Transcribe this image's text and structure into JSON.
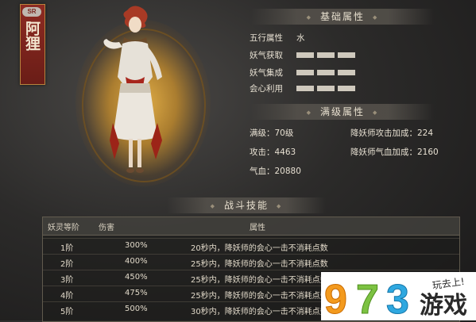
{
  "card": {
    "rarity": "SR",
    "name": "阿狸"
  },
  "sections": {
    "base": "基础属性",
    "max": "满级属性",
    "skills": "战斗技能"
  },
  "base_stats": [
    {
      "label": "五行属性",
      "value": "水"
    },
    {
      "label": "妖气获取",
      "value": ""
    },
    {
      "label": "妖气集成",
      "value": ""
    },
    {
      "label": "会心利用",
      "value": ""
    }
  ],
  "max_stats": {
    "level": "满级：70级",
    "attack": "攻击：4463",
    "hp": "气血：20880",
    "atk_bonus": "降妖师攻击加成：224",
    "hp_bonus": "降妖师气血加成：2160"
  },
  "skills_table": {
    "headers": [
      "妖灵等阶",
      "伤害",
      "属性"
    ],
    "rows": [
      {
        "tier": "1阶",
        "damage": "300%",
        "desc": "20秒内，降妖师的会心一击不消耗点数"
      },
      {
        "tier": "2阶",
        "damage": "400%",
        "desc": "25秒内，降妖师的会心一击不消耗点数"
      },
      {
        "tier": "3阶",
        "damage": "450%",
        "desc": "25秒内，降妖师的会心一击不消耗点数"
      },
      {
        "tier": "4阶",
        "damage": "475%",
        "desc": "25秒内，降妖师的会心一击不消耗点数"
      },
      {
        "tier": "5阶",
        "damage": "500%",
        "desc": "30秒内，降妖师的会心一击不消耗点数"
      }
    ]
  },
  "watermark": {
    "digits": "973",
    "site": "游戏",
    "slogan": "玩去上!"
  },
  "colors": {
    "accent_gold": "#e8b246",
    "banner_red": "#8e2b22",
    "digit_9": "#f39a1e",
    "digit_7": "#7cc242",
    "digit_3": "#2fa8e0"
  }
}
